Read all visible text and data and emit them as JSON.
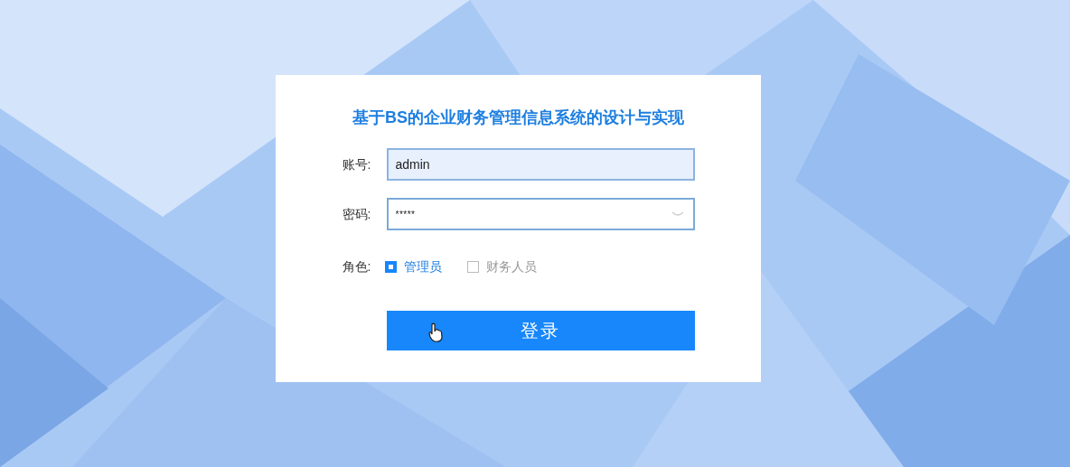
{
  "title": "基于BS的企业财务管理信息系统的设计与实现",
  "fields": [
    {
      "label": "账号:",
      "value": "admin",
      "kind": "text",
      "focused": true
    },
    {
      "label": "密码:",
      "value": "*****",
      "kind": "password",
      "focused": false
    }
  ],
  "role": {
    "label": "角色:",
    "options": [
      {
        "label": "管理员",
        "selected": true
      },
      {
        "label": "财务人员",
        "selected": false
      }
    ]
  },
  "login_button": "登录"
}
